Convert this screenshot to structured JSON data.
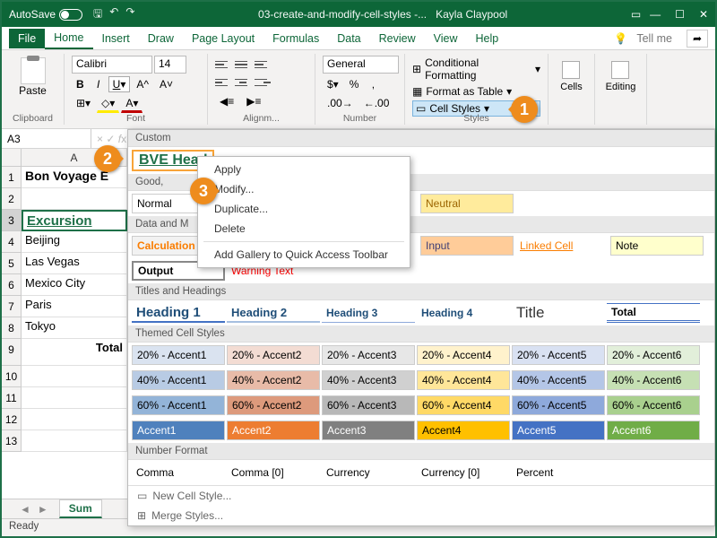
{
  "titlebar": {
    "autosave": "AutoSave",
    "docname": "03-create-and-modify-cell-styles -...",
    "user": "Kayla Claypool"
  },
  "tabs": {
    "file": "File",
    "home": "Home",
    "insert": "Insert",
    "draw": "Draw",
    "pagelayout": "Page Layout",
    "formulas": "Formulas",
    "data": "Data",
    "review": "Review",
    "view": "View",
    "help": "Help",
    "tellme": "Tell me"
  },
  "ribbon": {
    "paste": "Paste",
    "clipboard": "Clipboard",
    "font_name": "Calibri",
    "font_size": "14",
    "font": "Font",
    "alignment": "Alignm...",
    "number_format": "General",
    "number": "Number",
    "cond": "Conditional Formatting",
    "tbl": "Format as Table",
    "cellstyles": "Cell Styles",
    "styles": "Styles",
    "cells": "Cells",
    "editing": "Editing"
  },
  "namebox": "A3",
  "colA": "A",
  "rows": {
    "r1": "Bon Voyage E",
    "r3": "Excursion",
    "r4": "Beijing",
    "r5": "Las Vegas",
    "r6": "Mexico City",
    "r7": "Paris",
    "r8": "Tokyo",
    "r9": "Total"
  },
  "sheet": "Sum",
  "status": "Ready",
  "gallery": {
    "custom_h": "Custom",
    "custom_item": "BVE Head",
    "gbn_h": "Good,",
    "normal": "Normal",
    "neutral": "Neutral",
    "dm_h": "Data and M",
    "calc": "Calculation",
    "input": "Input",
    "linked": "Linked Cell",
    "note": "Note",
    "output": "Output",
    "warn": "Warning Text",
    "th_h": "Titles and Headings",
    "h1": "Heading 1",
    "h2": "Heading 2",
    "h3": "Heading 3",
    "h4": "Heading 4",
    "title": "Title",
    "total": "Total",
    "tcs_h": "Themed Cell Styles",
    "p20": "20% - Accent",
    "p40": "40% - Accent",
    "p60": "60% - Accent",
    "acc": "Accent",
    "nf_h": "Number Format",
    "comma": "Comma",
    "comma0": "Comma [0]",
    "currency": "Currency",
    "currency0": "Currency [0]",
    "percent": "Percent",
    "newstyle": "New Cell Style...",
    "merge": "Merge Styles..."
  },
  "ctx": {
    "apply": "Apply",
    "modify": "Modify...",
    "dup": "Duplicate...",
    "del": "Delete",
    "addqat": "Add Gallery to Quick Access Toolbar"
  },
  "callout": {
    "c1": "1",
    "c2": "2",
    "c3": "3"
  }
}
